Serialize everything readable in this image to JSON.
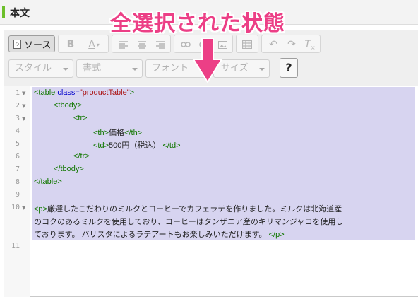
{
  "header": {
    "title": "本文"
  },
  "toolbar": {
    "source_label": "ソース",
    "bold_glyph": "B",
    "font_color_glyph": "A",
    "clear_format_glyph": "T",
    "styles": {
      "style_label": "スタイル",
      "format_label": "書式",
      "font_label": "フォント",
      "size_label": "サイズ"
    },
    "help_label": "?"
  },
  "code": {
    "line_numbers": [
      "1",
      "2",
      "3",
      "4",
      "5",
      "6",
      "7",
      "8",
      "9",
      "10",
      "11"
    ],
    "line1": {
      "open": "<table",
      "attr": "class=",
      "val": "\"productTable\"",
      "close": ">"
    },
    "line2": "<tbody>",
    "line3": "<tr>",
    "line4": {
      "open": "<th>",
      "text": "価格",
      "close": "</th>"
    },
    "line5": {
      "open": "<td>",
      "text": "500円（税込）",
      "close": "</td>"
    },
    "line6": "</tr>",
    "line7": "</tbody>",
    "line8": "</table>",
    "line10": {
      "open": "<p>",
      "text_a": "厳選したこだわりのミルクとコーヒーでカフェラテを作りました。ミルクは北海道産",
      "text_b": "のコクのあるミルクを使用しており、コーヒーはタンザニア産のキリマンジャロを使用し",
      "text_c": "ております。 バリスタによるラテアートもお楽しみいただけます。",
      "close": "</p>"
    }
  },
  "annotation": {
    "text": "全選択された状態",
    "color": "#ec3f86"
  }
}
